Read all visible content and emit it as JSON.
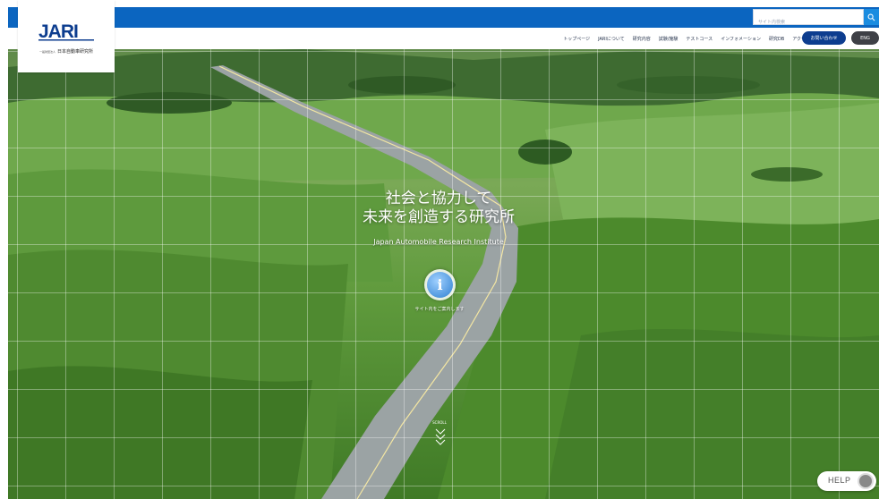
{
  "search": {
    "placeholder": "サイト内検索"
  },
  "logo": {
    "mark": "JARI",
    "prefix": "一般財団法人",
    "name": "日本自動車研究所"
  },
  "nav": {
    "items": [
      {
        "label": "トップページ"
      },
      {
        "label": "JARIについて"
      },
      {
        "label": "研究内容"
      },
      {
        "label": "試験/施験"
      },
      {
        "label": "テストコース"
      },
      {
        "label": "インフォメーション"
      },
      {
        "label": "研究DB"
      },
      {
        "label": "アクセス"
      }
    ],
    "contact_label": "お問い合わせ",
    "eng_label": "ENG"
  },
  "hero": {
    "tagline_line1": "社会と協力して",
    "tagline_line2": "未来を創造する研究所",
    "tagline_en": "Japan Automobile Research Institute",
    "info_icon_glyph": "i",
    "info_caption": "サイト内をご案内します",
    "scroll_label": "SCROLL"
  },
  "help": {
    "label": "HELP"
  },
  "colors": {
    "topbar": "#0b65c0",
    "contact": "#0d3d8f",
    "eng": "#3e4046",
    "search_button": "#1a8ce0"
  }
}
